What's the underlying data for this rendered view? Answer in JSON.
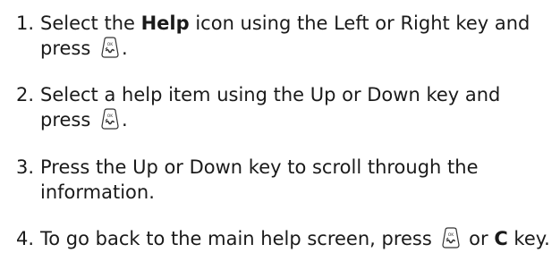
{
  "steps": [
    {
      "number": "1.",
      "text_a": "Select the ",
      "bold_a": "Help",
      "text_b": " icon using the Left or Right key and press ",
      "text_c": "."
    },
    {
      "number": "2.",
      "text_a": "Select a help item using the Up or Down key and press ",
      "text_b": "."
    },
    {
      "number": "3.",
      "text_a": "Press the Up or Down key to scroll through the information."
    },
    {
      "number": "4.",
      "text_a": "To go back to the main help screen, press ",
      "text_b": " or ",
      "bold_b": "C",
      "text_c": " key."
    }
  ],
  "icons": {
    "ok_key": "ok-key-icon"
  },
  "colors": {
    "text": "#1a1a1a",
    "icon_stroke": "#333333"
  }
}
